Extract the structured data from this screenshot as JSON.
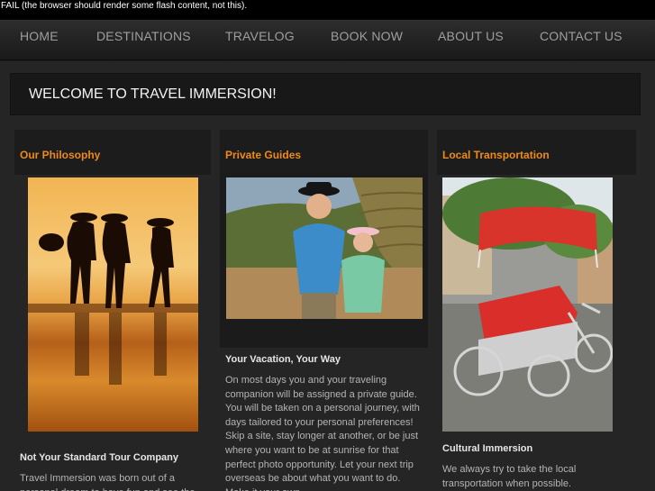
{
  "flash_notice": "FAIL (the browser should render some flash content, not this).",
  "nav": {
    "items": [
      {
        "label": "HOME"
      },
      {
        "label": "DESTINATIONS"
      },
      {
        "label": "TRAVELOG"
      },
      {
        "label": "BOOK NOW"
      },
      {
        "label": "ABOUT US"
      },
      {
        "label": "CONTACT US"
      }
    ]
  },
  "welcome": {
    "title": "WELCOME TO TRAVEL IMMERSION!"
  },
  "columns": [
    {
      "heading": "Our Philosophy",
      "photo_icon": "silhouettes-on-beach-photo",
      "subheading": "Not Your Standard Tour Company",
      "text": "Travel Immersion was born out of a personal dream to have fun and see the"
    },
    {
      "heading": "Private Guides",
      "photo_icon": "travelers-with-guide-photo",
      "subheading": "Your Vacation, Your Way",
      "text": "On most days you and your traveling companion will be assigned a private guide. You will be taken on a personal journey, with days tailored to your personal preferences! Skip a site, stay longer at another, or be just where you want to be at sunrise for that perfect photo opportunity. Let your next trip overseas be about what you want to do. Make it your own."
    },
    {
      "heading": "Local Transportation",
      "photo_icon": "cyclo-rickshaw-photo",
      "subheading": "Cultural Immersion",
      "text": "We always try to take the local transportation when possible."
    }
  ],
  "colors": {
    "accent": "#ee8a1a",
    "background": "#252525",
    "nav_text": "#9e9e9e"
  }
}
